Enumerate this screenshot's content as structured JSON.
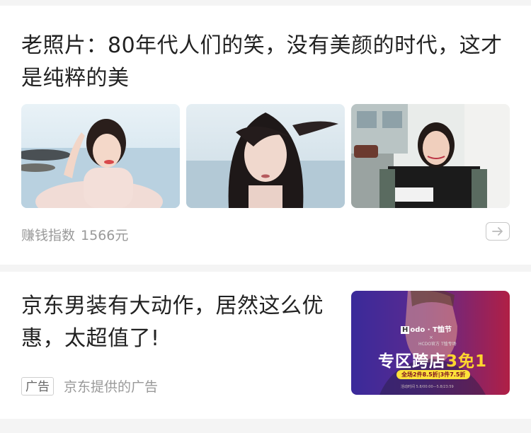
{
  "feed": {
    "article": {
      "title": "老照片：80年代人们的笑，没有美颜的时代，这才是纯粹的美",
      "stat_label": "赚钱指数",
      "stat_value": "1566元",
      "thumbnails": [
        "beach-portrait-photo",
        "windblown-hair-portrait-photo",
        "street-portrait-photo"
      ]
    },
    "ad": {
      "title": "京东男装有大动作，居然这么优惠，太超值了!",
      "badge": "广告",
      "source": "京东提供的广告",
      "image": {
        "brand": "odo · T恤节",
        "brand_box": "H",
        "cross": "×",
        "sub": "HCDO官方 T恤专场",
        "headline_main": "专区跨店",
        "headline_highlight": "3免1",
        "pill": "全场2件8.5折|3件7.5折",
        "fine": "活动时间 5.8/00:00—5.8/23:59"
      }
    }
  },
  "colors": {
    "page_bg": "#f4f4f4",
    "card_bg": "#ffffff",
    "title_text": "#222222",
    "meta_text": "#999999",
    "ad_highlight": "#ffd62e"
  }
}
